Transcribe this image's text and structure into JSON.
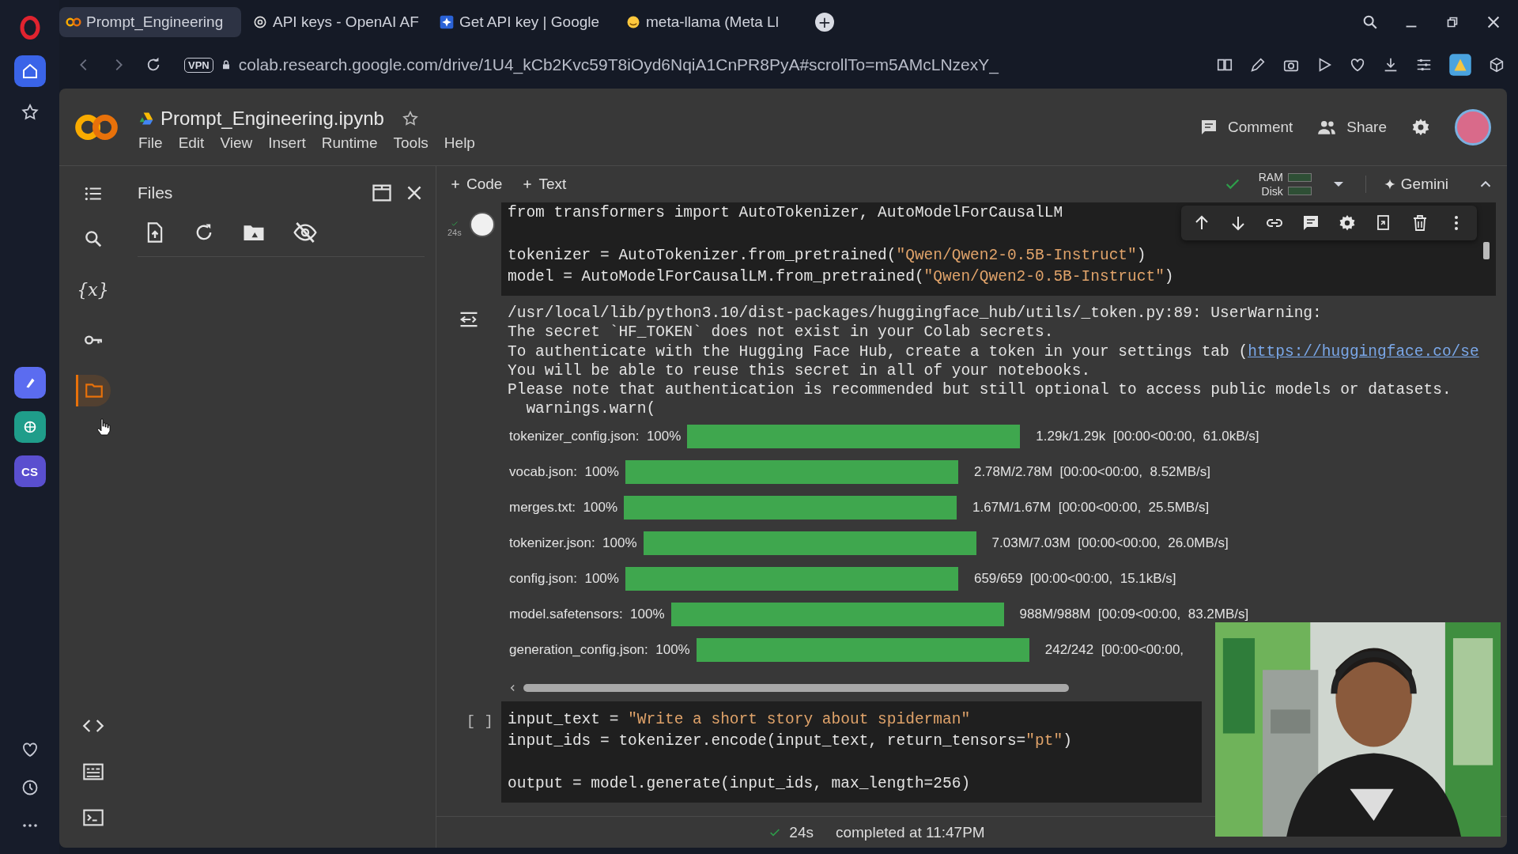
{
  "browser": {
    "tabs": [
      {
        "title": "Prompt_Engineering",
        "selected": true
      },
      {
        "title": "API keys - OpenAI AF",
        "selected": false
      },
      {
        "title": "Get API key | Google",
        "selected": false
      },
      {
        "title": "meta-llama (Meta Ll",
        "selected": false
      }
    ],
    "new_tab": "+",
    "vpn": "VPN",
    "url": "colab.research.google.com/drive/1U4_kCb2Kvc59T8iOyd6NqiA1CnPR8PyA#scrollTo=m5AMcLNzexY_",
    "sidebar_apps": [
      {
        "kind": "drawing",
        "color": "#5b6cf0"
      },
      {
        "kind": "globe",
        "color": "#1f9d8a"
      },
      {
        "kind": "text",
        "label": "CS",
        "color": "#5a4fcf"
      }
    ]
  },
  "notebook": {
    "title": "Prompt_Engineering.ipynb",
    "starred": false,
    "menu": [
      "File",
      "Edit",
      "View",
      "Insert",
      "Runtime",
      "Tools",
      "Help"
    ],
    "comment": "Comment",
    "share": "Share",
    "toolbar": {
      "add_code": "Code",
      "add_text": "Text",
      "ram": "RAM",
      "disk": "Disk",
      "gemini": "Gemini"
    },
    "rail": [
      {
        "kind": "search",
        "selected": false
      },
      {
        "kind": "variables",
        "glyph": "{x}",
        "selected": false
      },
      {
        "kind": "secrets",
        "selected": false
      },
      {
        "kind": "files",
        "selected": true
      }
    ],
    "files_panel": {
      "title": "Files"
    },
    "cells": [
      {
        "kind": "code",
        "ran": true,
        "time": "24s",
        "code": "from transformers import AutoTokenizer, AutoModelForCausalLM\n\ntokenizer = AutoTokenizer.from_pretrained(\"Qwen/Qwen2-0.5B-Instruct\")\nmodel = AutoModelForCausalLM.from_pretrained(\"Qwen/Qwen2-0.5B-Instruct\")",
        "output": [
          {
            "text": "/usr/local/lib/python3.10/dist-packages/huggingface_hub/utils/_token.py:89: UserWarning:"
          },
          {
            "text": "The secret `HF_TOKEN` does not exist in your Colab secrets."
          },
          {
            "text": "To authenticate with the Hugging Face Hub, create a token in your settings tab (",
            "link": "https://huggingface.co/se"
          },
          {
            "text": "You will be able to reuse this secret in all of your notebooks."
          },
          {
            "text": "Please note that authentication is recommended but still optional to access public models or datasets."
          },
          {
            "text": "  warnings.warn("
          }
        ],
        "progress": [
          {
            "label": "tokenizer_config.json:  100%",
            "level": 1,
            "stats": "1.29k/1.29k  [00:00<00:00,  61.0kB/s]"
          },
          {
            "label": "vocab.json:  100%",
            "level": 1,
            "stats": "2.78M/2.78M  [00:00<00:00,  8.52MB/s]"
          },
          {
            "label": "merges.txt:  100%",
            "level": 1,
            "stats": "1.67M/1.67M  [00:00<00:00,  25.5MB/s]"
          },
          {
            "label": "tokenizer.json:  100%",
            "level": 1,
            "stats": "7.03M/7.03M  [00:00<00:00,  26.0MB/s]"
          },
          {
            "label": "config.json:  100%",
            "level": 1,
            "stats": "659/659  [00:00<00:00,  15.1kB/s]"
          },
          {
            "label": "model.safetensors:  100%",
            "level": 1,
            "stats": "988M/988M  [00:09<00:00,  83.2MB/s]"
          },
          {
            "label": "generation_config.json:  100%",
            "level": 1,
            "stats": "242/242  [00:00<00:00,"
          }
        ]
      },
      {
        "kind": "code",
        "ran": false,
        "prompt": "[ ]",
        "code": "input_text = \"Write a short story about spiderman\"\ninput_ids = tokenizer.encode(input_text, return_tensors=\"pt\")\n\noutput = model.generate(input_ids, max_length=256)"
      }
    ],
    "status": {
      "time": "24s",
      "text": "completed at 11:47PM"
    }
  }
}
